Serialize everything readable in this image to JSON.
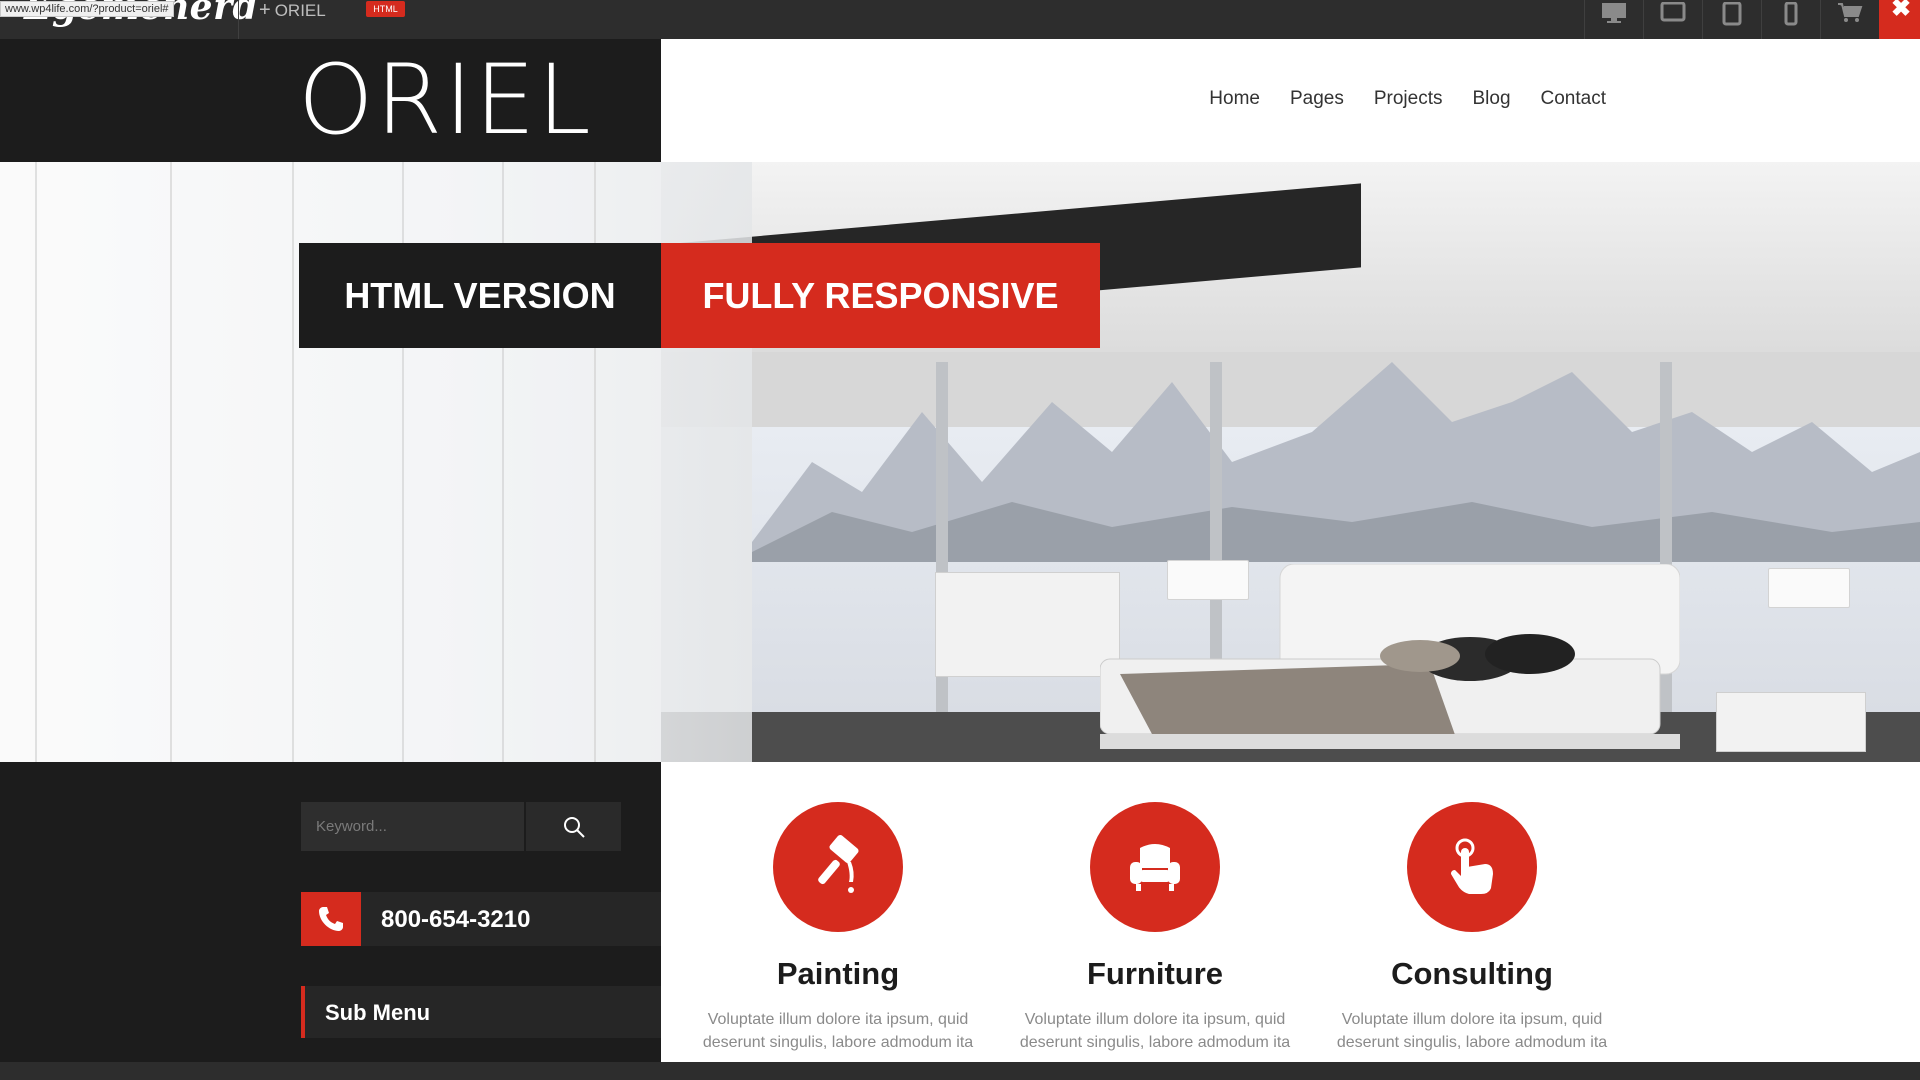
{
  "topbar": {
    "brand": "Egemenerd",
    "product_label": "ORIEL",
    "badge": "HTML",
    "devices": [
      "desktop-icon",
      "tablet-landscape-icon",
      "tablet-portrait-icon",
      "phone-icon",
      "cart-icon"
    ],
    "close_symbol": "✖"
  },
  "header": {
    "logo": "ORIEL",
    "nav": [
      "Home",
      "Pages",
      "Projects",
      "Blog",
      "Contact"
    ]
  },
  "hero": {
    "banner_left": "HTML VERSION",
    "banner_right": "FULLY RESPONSIVE"
  },
  "sidebar": {
    "search_placeholder": "Keyword...",
    "phone": "800-654-3210",
    "submenu": "Sub Menu"
  },
  "services": [
    {
      "title": "Painting",
      "icon": "paint-roller-icon",
      "text": "Voluptate illum dolore ita ipsum, quid deserunt singulis, labore admodum ita"
    },
    {
      "title": "Furniture",
      "icon": "armchair-icon",
      "text": "Voluptate illum dolore ita ipsum, quid deserunt singulis, labore admodum ita"
    },
    {
      "title": "Consulting",
      "icon": "hand-pointer-icon",
      "text": "Voluptate illum dolore ita ipsum, quid deserunt singulis, labore admodum ita"
    }
  ],
  "status": {
    "url": "www.wp4life.com/?product=oriel#"
  },
  "colors": {
    "accent": "#d52b1e",
    "dark": "#1c1c1c",
    "toolbar": "#2d2d2d"
  }
}
